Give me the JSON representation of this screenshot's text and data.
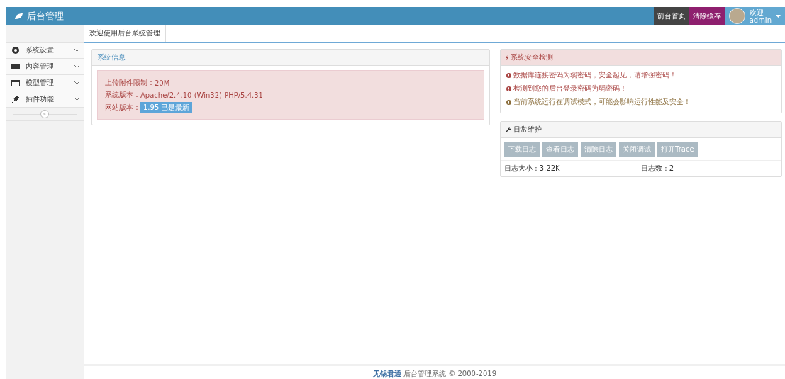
{
  "header": {
    "logo_text": "后台管理",
    "buttons": [
      {
        "label": "前台首页",
        "kind": "dark"
      },
      {
        "label": "清除缓存",
        "kind": "purple"
      }
    ],
    "user": {
      "greeting": "欢迎",
      "name": "admin"
    }
  },
  "sidebar": {
    "items": [
      {
        "label": "系统设置",
        "expanded": false
      },
      {
        "label": "内容管理",
        "expanded": false
      },
      {
        "label": "模型管理",
        "expanded": false
      },
      {
        "label": "插件功能",
        "expanded": false
      }
    ],
    "collapse_symbol": "«"
  },
  "tabs": [
    {
      "label": "欢迎使用后台系统管理",
      "selected": true
    }
  ],
  "system_info": {
    "title": "系统信息",
    "lines": [
      {
        "label": "上传附件限制：",
        "value": "20M"
      },
      {
        "label": "系统版本：",
        "value": "Apache/2.4.10 (Win32) PHP/5.4.31"
      },
      {
        "label": "网站版本：",
        "badge": "1.95 已是最新"
      }
    ]
  },
  "security": {
    "title": "系统安全检测",
    "alerts": [
      {
        "kind": "danger",
        "text": "数据库连接密码为弱密码，安全起见，请增强密码！"
      },
      {
        "kind": "danger",
        "text": "检测到您的后台登录密码为弱密码！"
      },
      {
        "kind": "warning",
        "text": "当前系统运行在调试模式，可能会影响运行性能及安全！"
      }
    ]
  },
  "maintenance": {
    "title": "日常维护",
    "buttons": [
      "下载日志",
      "查看日志",
      "清除日志",
      "关闭调试",
      "打开Trace"
    ],
    "log_size": "日志大小 : 3.22K",
    "log_count": "日志数 : 2"
  },
  "footer": {
    "text": "**无锡君通** 后台管理系统 © 2000-2019"
  }
}
